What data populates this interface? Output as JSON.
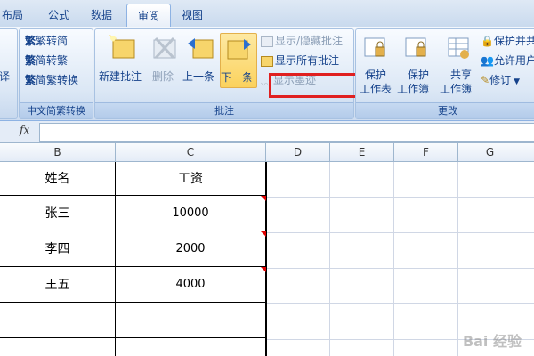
{
  "tabs": [
    {
      "label": "布局"
    },
    {
      "label": "公式"
    },
    {
      "label": "数据"
    },
    {
      "label": "审阅"
    },
    {
      "label": "视图"
    }
  ],
  "ribbon": {
    "chinese_group": {
      "label": "中文简繁转换",
      "to_simplified": "繁转简",
      "to_traditional": "简转繁",
      "convert": "简繁转换"
    },
    "comments_group": {
      "label": "批注",
      "new_comment": "新建批注",
      "delete": "删除",
      "previous": "上一条",
      "next": "下一条",
      "show_hide": "显示/隐藏批注",
      "show_all": "显示所有批注",
      "show_ink": "显示墨迹"
    },
    "changes_group": {
      "label": "更改",
      "protect_sheet_1": "保护",
      "protect_sheet_2": "工作表",
      "protect_workbook_1": "保护",
      "protect_workbook_2": "工作簿",
      "share_workbook_1": "共享",
      "share_workbook_2": "工作簿",
      "protect_share": "保护并共",
      "allow_edit": "允许用户",
      "track": "修订"
    },
    "left_partial": "译"
  },
  "formula_bar": {
    "fx": "fx",
    "value": ""
  },
  "columns": [
    "B",
    "C",
    "D",
    "E",
    "F",
    "G"
  ],
  "table": {
    "headers": [
      "姓名",
      "工资"
    ],
    "rows": [
      [
        "张三",
        "10000"
      ],
      [
        "李四",
        "2000"
      ],
      [
        "王五",
        "4000"
      ]
    ]
  },
  "watermark": "Bai 经验"
}
